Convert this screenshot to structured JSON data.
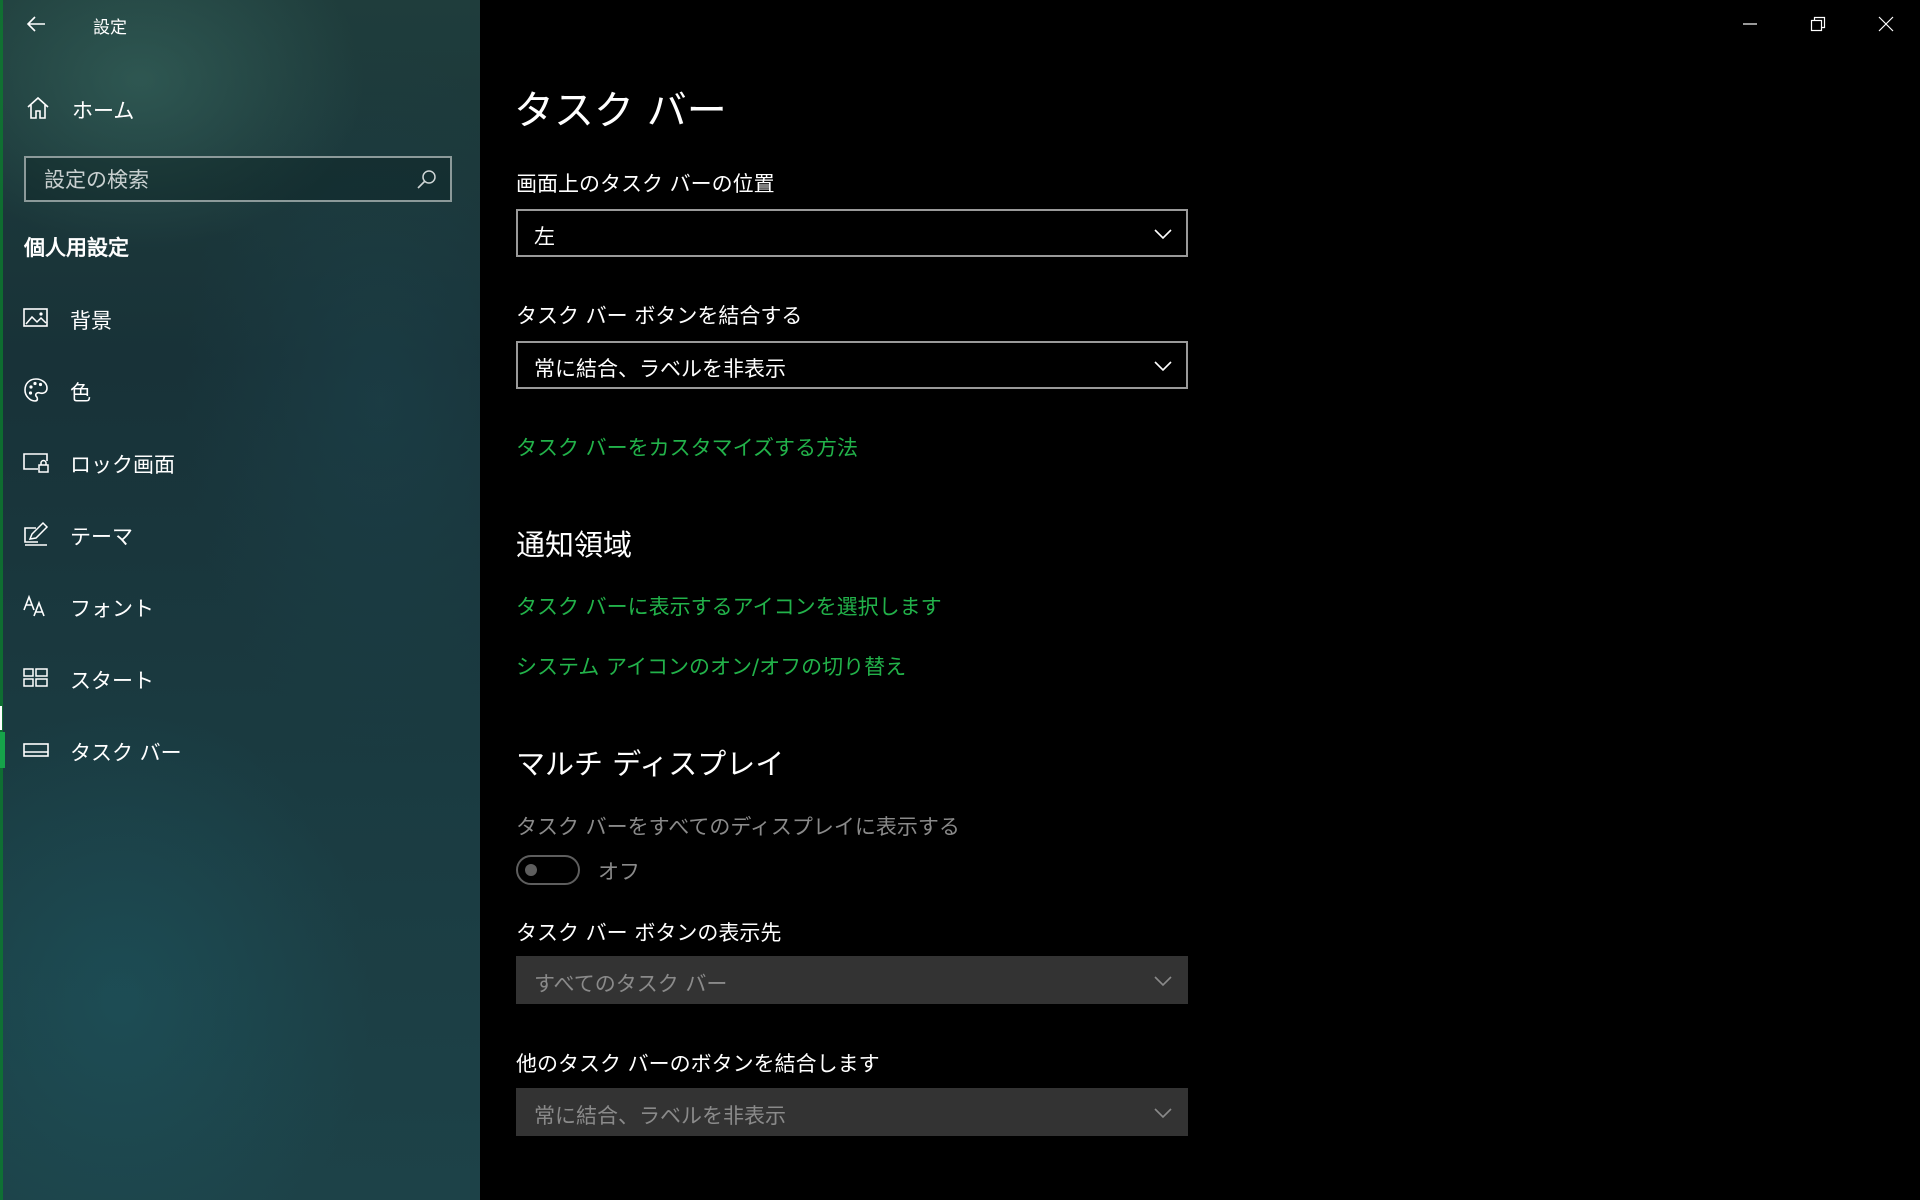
{
  "window": {
    "title": "設定",
    "controls": {
      "minimize_icon": "minimize-icon",
      "restore_icon": "restore-icon",
      "close_icon": "close-icon"
    }
  },
  "sidebar": {
    "home_label": "ホーム",
    "search_placeholder": "設定の検索",
    "section_title": "個人用設定",
    "items": [
      {
        "label": "背景",
        "icon": "picture-icon"
      },
      {
        "label": "色",
        "icon": "palette-icon"
      },
      {
        "label": "ロック画面",
        "icon": "lock-screen-icon"
      },
      {
        "label": "テーマ",
        "icon": "theme-icon"
      },
      {
        "label": "フォント",
        "icon": "font-icon"
      },
      {
        "label": "スタート",
        "icon": "start-icon"
      },
      {
        "label": "タスク バー",
        "icon": "taskbar-icon",
        "active": true
      }
    ]
  },
  "main": {
    "page_title": "タスク バー",
    "position": {
      "label": "画面上のタスク バーの位置",
      "value": "左"
    },
    "combine": {
      "label": "タスク バー ボタンを結合する",
      "value": "常に結合、ラベルを非表示"
    },
    "customize_link": "タスク バーをカスタマイズする方法",
    "notification_area": {
      "heading": "通知領域",
      "link_select_icons": "タスク バーに表示するアイコンを選択します",
      "link_system_icons": "システム アイコンのオン/オフの切り替え"
    },
    "multi_display": {
      "heading": "マルチ ディスプレイ",
      "show_all_label": "タスク バーをすべてのディスプレイに表示する",
      "toggle_state": "オフ",
      "buttons_on_label": "タスク バー ボタンの表示先",
      "buttons_on_value": "すべてのタスク バー",
      "combine_other_label": "他のタスク バーのボタンを結合します",
      "combine_other_value": "常に結合、ラベルを非表示"
    }
  },
  "colors": {
    "accent": "#22b24a",
    "active_indicator": "#16a34a"
  }
}
